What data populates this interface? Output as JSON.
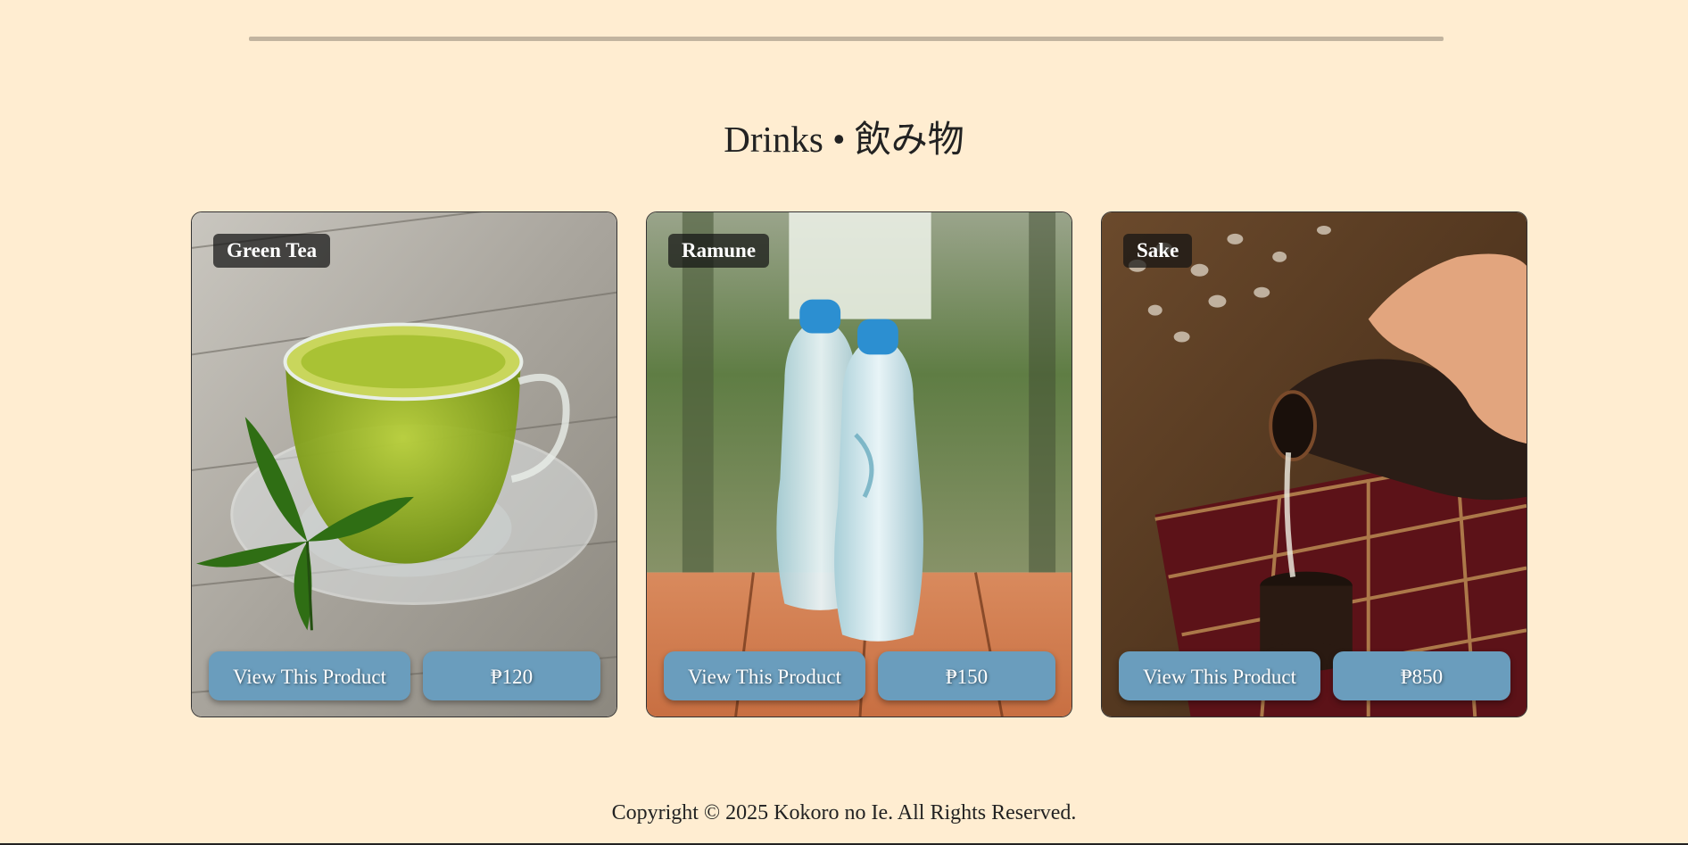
{
  "section": {
    "title": "Drinks • 飲み物"
  },
  "products": [
    {
      "name": "Green Tea",
      "view_label": "View This Product",
      "price": "₱120"
    },
    {
      "name": "Ramune",
      "view_label": "View This Product",
      "price": "₱150"
    },
    {
      "name": "Sake",
      "view_label": "View This Product",
      "price": "₱850"
    }
  ],
  "footer": {
    "copyright": "Copyright © 2025 Kokoro no Ie. All Rights Reserved."
  },
  "colors": {
    "page_background": "#ffedd1",
    "button": "#6a9dbd",
    "divider": "#c2b49f"
  }
}
